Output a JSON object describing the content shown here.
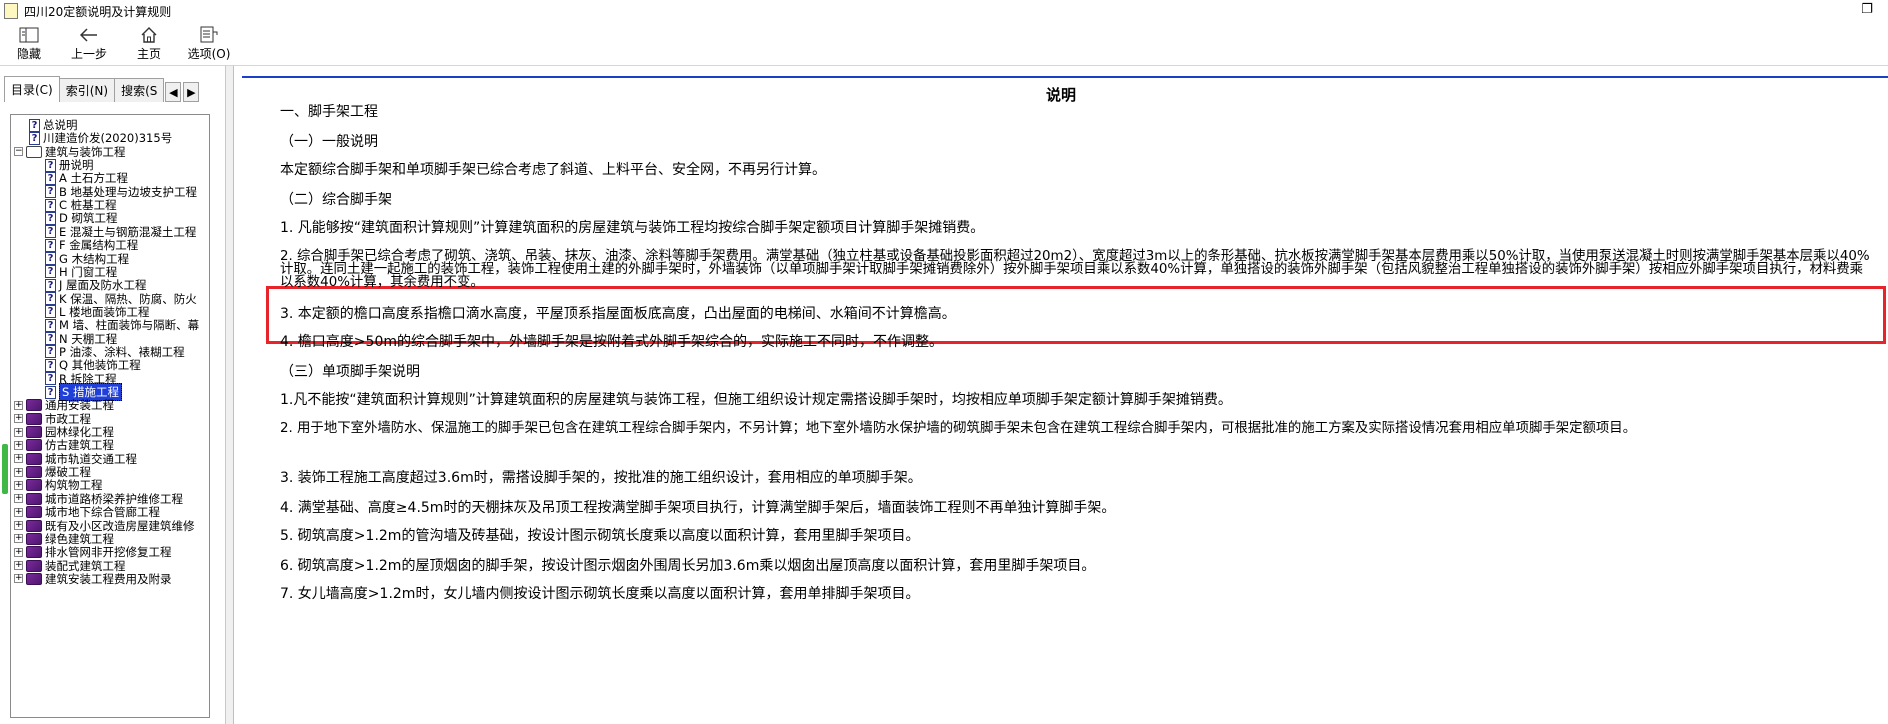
{
  "window": {
    "title": "四川20定额说明及计算规则",
    "restore_symbol": "❐"
  },
  "toolbar": {
    "buttons": [
      {
        "label": "隐藏",
        "icon": "hide-icon"
      },
      {
        "label": "上一步",
        "icon": "back-arrow-icon"
      },
      {
        "label": "主页",
        "icon": "home-icon"
      },
      {
        "label": "选项(O)",
        "icon": "options-icon"
      }
    ]
  },
  "sidebar": {
    "tabs": [
      "目录(C)",
      "索引(N)",
      "搜索(S"
    ],
    "arrow_left": "◀",
    "arrow_right": "▶",
    "tree": [
      {
        "label": "总说明",
        "level": 1,
        "type": "page"
      },
      {
        "label": "川建造价发(2020)315号",
        "level": 1,
        "type": "page"
      },
      {
        "label": "建筑与装饰工程",
        "level": 0,
        "type": "book-open",
        "expander": "−"
      },
      {
        "label": "册说明",
        "level": 2,
        "type": "page"
      },
      {
        "label": "A 土石方工程",
        "level": 2,
        "type": "page"
      },
      {
        "label": "B 地基处理与边坡支护工程",
        "level": 2,
        "type": "page"
      },
      {
        "label": "C 桩基工程",
        "level": 2,
        "type": "page"
      },
      {
        "label": "D 砌筑工程",
        "level": 2,
        "type": "page"
      },
      {
        "label": "E 混凝土与钢筋混凝土工程",
        "level": 2,
        "type": "page"
      },
      {
        "label": "F 金属结构工程",
        "level": 2,
        "type": "page"
      },
      {
        "label": "G 木结构工程",
        "level": 2,
        "type": "page"
      },
      {
        "label": "H 门窗工程",
        "level": 2,
        "type": "page"
      },
      {
        "label": "J 屋面及防水工程",
        "level": 2,
        "type": "page"
      },
      {
        "label": "K 保温、隔热、防腐、防火",
        "level": 2,
        "type": "page"
      },
      {
        "label": "L 楼地面装饰工程",
        "level": 2,
        "type": "page"
      },
      {
        "label": "M 墙、柱面装饰与隔断、幕",
        "level": 2,
        "type": "page"
      },
      {
        "label": "N 天棚工程",
        "level": 2,
        "type": "page"
      },
      {
        "label": "P 油漆、涂料、裱糊工程",
        "level": 2,
        "type": "page"
      },
      {
        "label": "Q 其他装饰工程",
        "level": 2,
        "type": "page"
      },
      {
        "label": "R 拆除工程",
        "level": 2,
        "type": "page"
      },
      {
        "label": "S 措施工程",
        "level": 2,
        "type": "page",
        "selected": true
      },
      {
        "label": "通用安装工程",
        "level": 0,
        "type": "book",
        "expander": "+"
      },
      {
        "label": "市政工程",
        "level": 0,
        "type": "book",
        "expander": "+"
      },
      {
        "label": "园林绿化工程",
        "level": 0,
        "type": "book",
        "expander": "+"
      },
      {
        "label": "仿古建筑工程",
        "level": 0,
        "type": "book",
        "expander": "+"
      },
      {
        "label": "城市轨道交通工程",
        "level": 0,
        "type": "book",
        "expander": "+"
      },
      {
        "label": "爆破工程",
        "level": 0,
        "type": "book",
        "expander": "+"
      },
      {
        "label": "构筑物工程",
        "level": 0,
        "type": "book",
        "expander": "+"
      },
      {
        "label": "城市道路桥梁养护维修工程",
        "level": 0,
        "type": "book",
        "expander": "+"
      },
      {
        "label": "城市地下综合管廊工程",
        "level": 0,
        "type": "book",
        "expander": "+"
      },
      {
        "label": "既有及小区改造房屋建筑维修",
        "level": 0,
        "type": "book",
        "expander": "+"
      },
      {
        "label": "绿色建筑工程",
        "level": 0,
        "type": "book",
        "expander": "+"
      },
      {
        "label": "排水管网非开挖修复工程",
        "level": 0,
        "type": "book",
        "expander": "+"
      },
      {
        "label": "装配式建筑工程",
        "level": 0,
        "type": "book",
        "expander": "+"
      },
      {
        "label": "建筑安装工程费用及附录",
        "level": 0,
        "type": "book",
        "expander": "+"
      }
    ]
  },
  "content": {
    "title": "说明",
    "paragraphs": [
      "一、脚手架工程",
      "（一）一般说明",
      "本定额综合脚手架和单项脚手架已综合考虑了斜道、上料平台、安全网，不再另行计算。",
      "（二）综合脚手架",
      "1. 凡能够按“建筑面积计算规则”计算建筑面积的房屋建筑与装饰工程均按综合脚手架定额项目计算脚手架摊销费。",
      "2. 综合脚手架已综合考虑了砌筑、浇筑、吊装、抹灰、油漆、涂料等脚手架费用。满堂基础（独立柱基或设备基础投影面积超过20m2）、宽度超过3m以上的条形基础、抗水板按满堂脚手架基本层费用乘以50%计取，当使用泵送混凝土时则按满堂脚手架基本层乘以40%计取。连同土建一起施工的装饰工程，装饰工程使用土建的外脚手架时，外墙装饰（以单项脚手架计取脚手架摊销费除外）按外脚手架项目乘以系数40%计算，单独搭设的装饰外脚手架（包括风貌整治工程单独搭设的装饰外脚手架）按相应外脚手架项目执行，材料费乘以系数40%计算，其余费用不变。",
      "3. 本定额的檐口高度系指檐口滴水高度，平屋顶系指屋面板底高度，凸出屋面的电梯间、水箱间不计算檐高。",
      "4. 檐口高度>50m的综合脚手架中，外墙脚手架是按附着式外脚手架综合的，实际施工不同时，不作调整。",
      "（三）单项脚手架说明",
      "1.凡不能按“建筑面积计算规则”计算建筑面积的房屋建筑与装饰工程，但施工组织设计规定需搭设脚手架时，均按相应单项脚手架定额计算脚手架摊销费。",
      "2. 用于地下室外墙防水、保温施工的脚手架已包含在建筑工程综合脚手架内，不另计算；地下室外墙防水保护墙的砌筑脚手架未包含在建筑工程综合脚手架内，可根据批准的施工方案及实际搭设情况套用相应单项脚手架定额项目。",
      "3. 装饰工程施工高度超过3.6m时，需搭设脚手架的，按批准的施工组织设计，套用相应的单项脚手架。",
      "4. 满堂基础、高度≥4.5m时的天棚抹灰及吊顶工程按满堂脚手架项目执行，计算满堂脚手架后，墙面装饰工程则不再单独计算脚手架。",
      "5. 砌筑高度>1.2m的管沟墙及砖基础，按设计图示砌筑长度乘以高度以面积计算，套用里脚手架项目。",
      "6. 砌筑高度>1.2m的屋顶烟囱的脚手架，按设计图示烟囱外围周长另加3.6m乘以烟囱出屋顶高度以面积计算，套用里脚手架项目。",
      "7. 女儿墙高度>1.2m时，女儿墙内侧按设计图示砌筑长度乘以高度以面积计算，套用单排脚手架项目。"
    ]
  }
}
